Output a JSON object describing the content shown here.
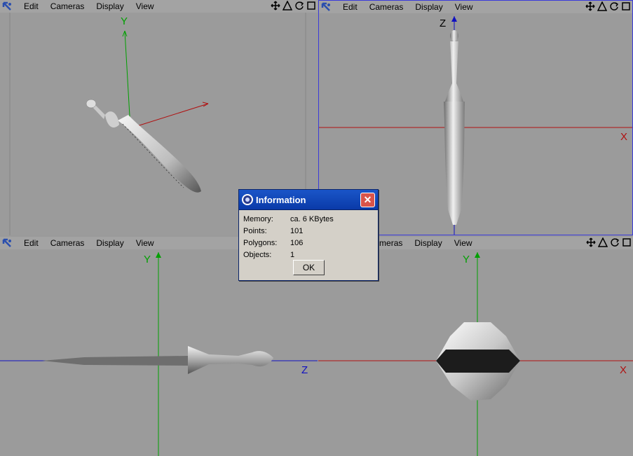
{
  "menu": [
    "Edit",
    "Cameras",
    "Display",
    "View"
  ],
  "axes": {
    "persp": {
      "y": "Y"
    },
    "front": {
      "z": "Z",
      "x": "X"
    },
    "side": {
      "y": "Y",
      "z": "Z"
    },
    "top": {
      "y": "Y",
      "x": "X"
    }
  },
  "colors": {
    "x_axis": "#b01010",
    "y_axis": "#00a000",
    "z_axis": "#1010c0",
    "active_border": "#3a3adb"
  },
  "dialog": {
    "title": "Information",
    "close_glyph": "✕",
    "rows": [
      {
        "label": "Memory:",
        "value": "ca. 6 KBytes"
      },
      {
        "label": "Points:",
        "value": "101"
      },
      {
        "label": "Polygons:",
        "value": "106"
      },
      {
        "label": "Objects:",
        "value": "1"
      }
    ],
    "ok_label": "OK"
  }
}
